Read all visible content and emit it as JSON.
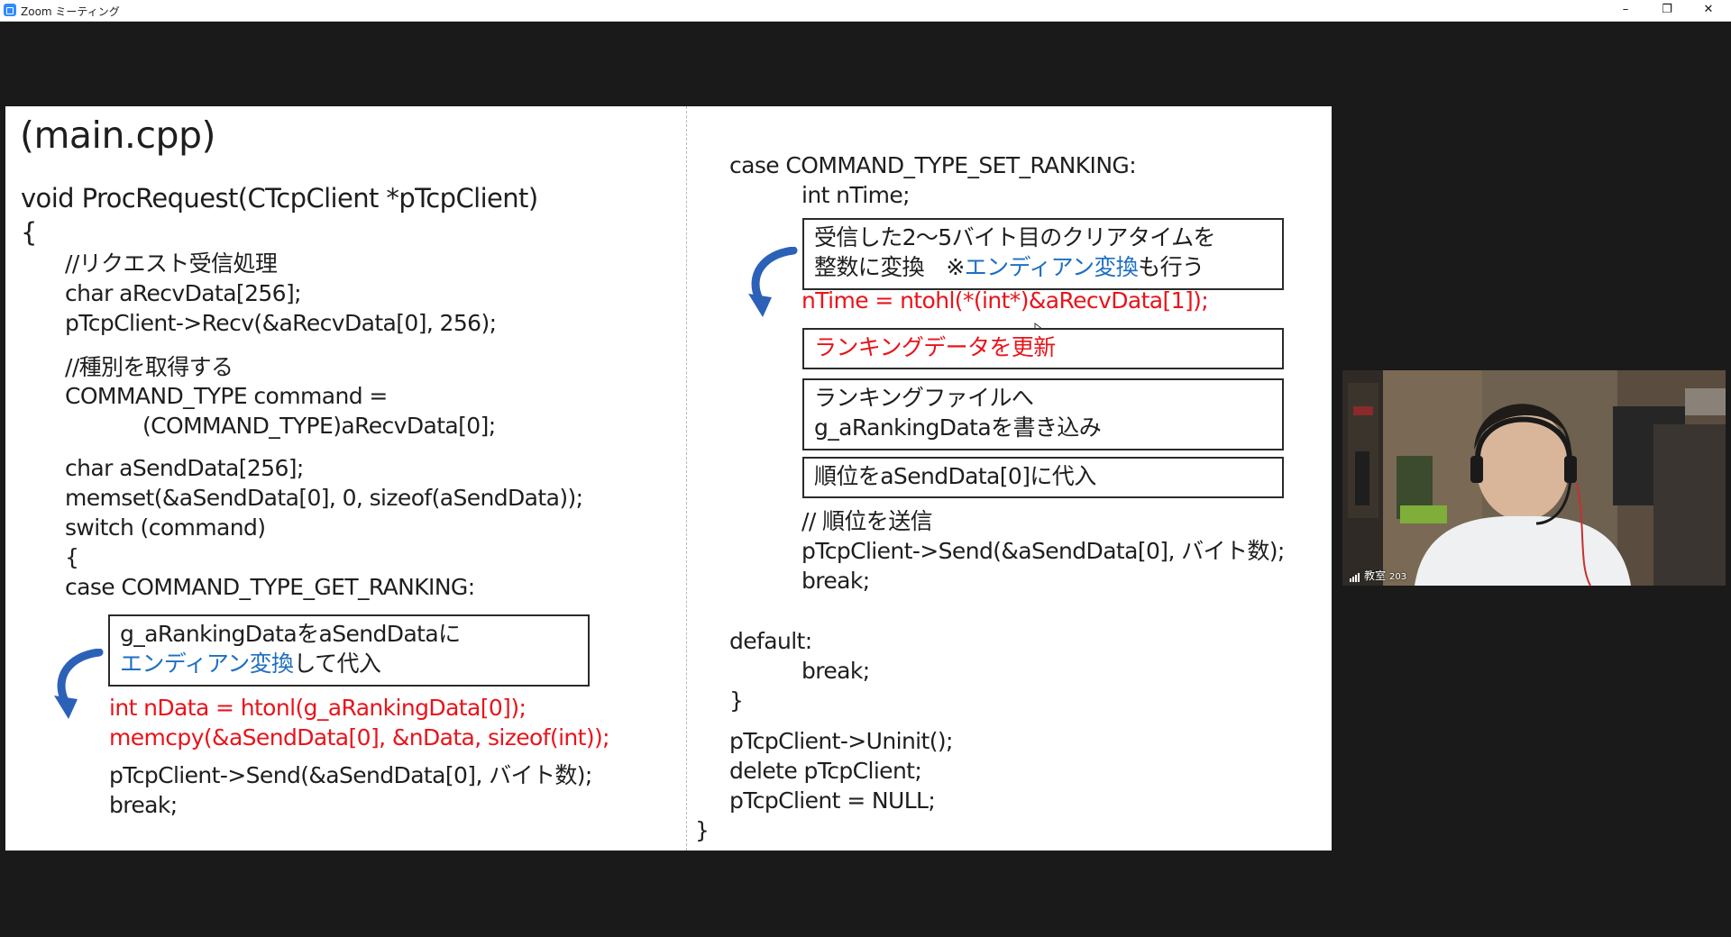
{
  "window": {
    "title": "Zoom ミーティング",
    "minimize_glyph": "–",
    "maximize_glyph": "❐",
    "close_glyph": "✕"
  },
  "slide": {
    "heading": "(main.cpp)",
    "left": {
      "func_sig": "void ProcRequest(CTcpClient *pTcpClient)",
      "open_brace": "{",
      "comment_receive": "//リクエスト受信処理",
      "recv_decl": "char aRecvData[256];",
      "recv_call": "pTcpClient->Recv(&aRecvData[0], 256);",
      "comment_type": "//種別を取得する",
      "command_decl": "COMMAND_TYPE command =",
      "command_cast": "(COMMAND_TYPE)aRecvData[0];",
      "send_decl": "char aSendData[256];",
      "memset_call": "memset(&aSendData[0], 0, sizeof(aSendData));",
      "switch_stmt": "switch (command)",
      "switch_brace": "{",
      "case_get": "case COMMAND_TYPE_GET_RANKING:",
      "note_line1": "g_aRankingDataをaSendDataに",
      "note_line2_blue": "エンディアン変換",
      "note_line2_rest": "して代入",
      "htonl_line": "int nData = htonl(g_aRankingData[0]);",
      "memcpy_line": "memcpy(&aSendData[0], &nData, sizeof(int));",
      "send_call": "pTcpClient->Send(&aSendData[0], バイト数);",
      "break_stmt": "break;"
    },
    "right": {
      "case_set": "case COMMAND_TYPE_SET_RANKING:",
      "ntime_decl": "int nTime;",
      "note_line1": "受信した2～5バイト目のクリアタイムを",
      "note_line2_a": "整数に変換　※",
      "note_line2_blue": "エンディアン変換",
      "note_line2_b": "も行う",
      "ntohl_line": "nTime = ntohl(*(int*)&aRecvData[1]);",
      "update_box": "ランキングデータを更新",
      "file_box_line1": "ランキングファイルへ",
      "file_box_line2": "g_aRankingDataを書き込み",
      "rank_box": "順位をaSendData[0]に代入",
      "comment_send_rank": "// 順位を送信",
      "send_call": "pTcpClient->Send(&aSendData[0], バイト数);",
      "break1": "break;",
      "default_label": "default:",
      "break2": "break;",
      "close_switch": "}",
      "uninit_call": "pTcpClient->Uninit();",
      "delete_stmt": "delete pTcpClient;",
      "null_assign": "pTcpClient = NULL;",
      "close_func": "}"
    }
  },
  "participant": {
    "name": "教室",
    "room_number": "203"
  },
  "colors": {
    "highlight_red": "#e8141b",
    "highlight_blue": "#1e6fc0",
    "arrow_blue": "#2c61b8",
    "app_background": "#1a1a1a"
  },
  "icons": {
    "app": "zoom-app-icon",
    "curved_arrow": "curved-arrow-icon",
    "signal": "signal-strength-icon",
    "cursor": "mouse-cursor-icon"
  }
}
